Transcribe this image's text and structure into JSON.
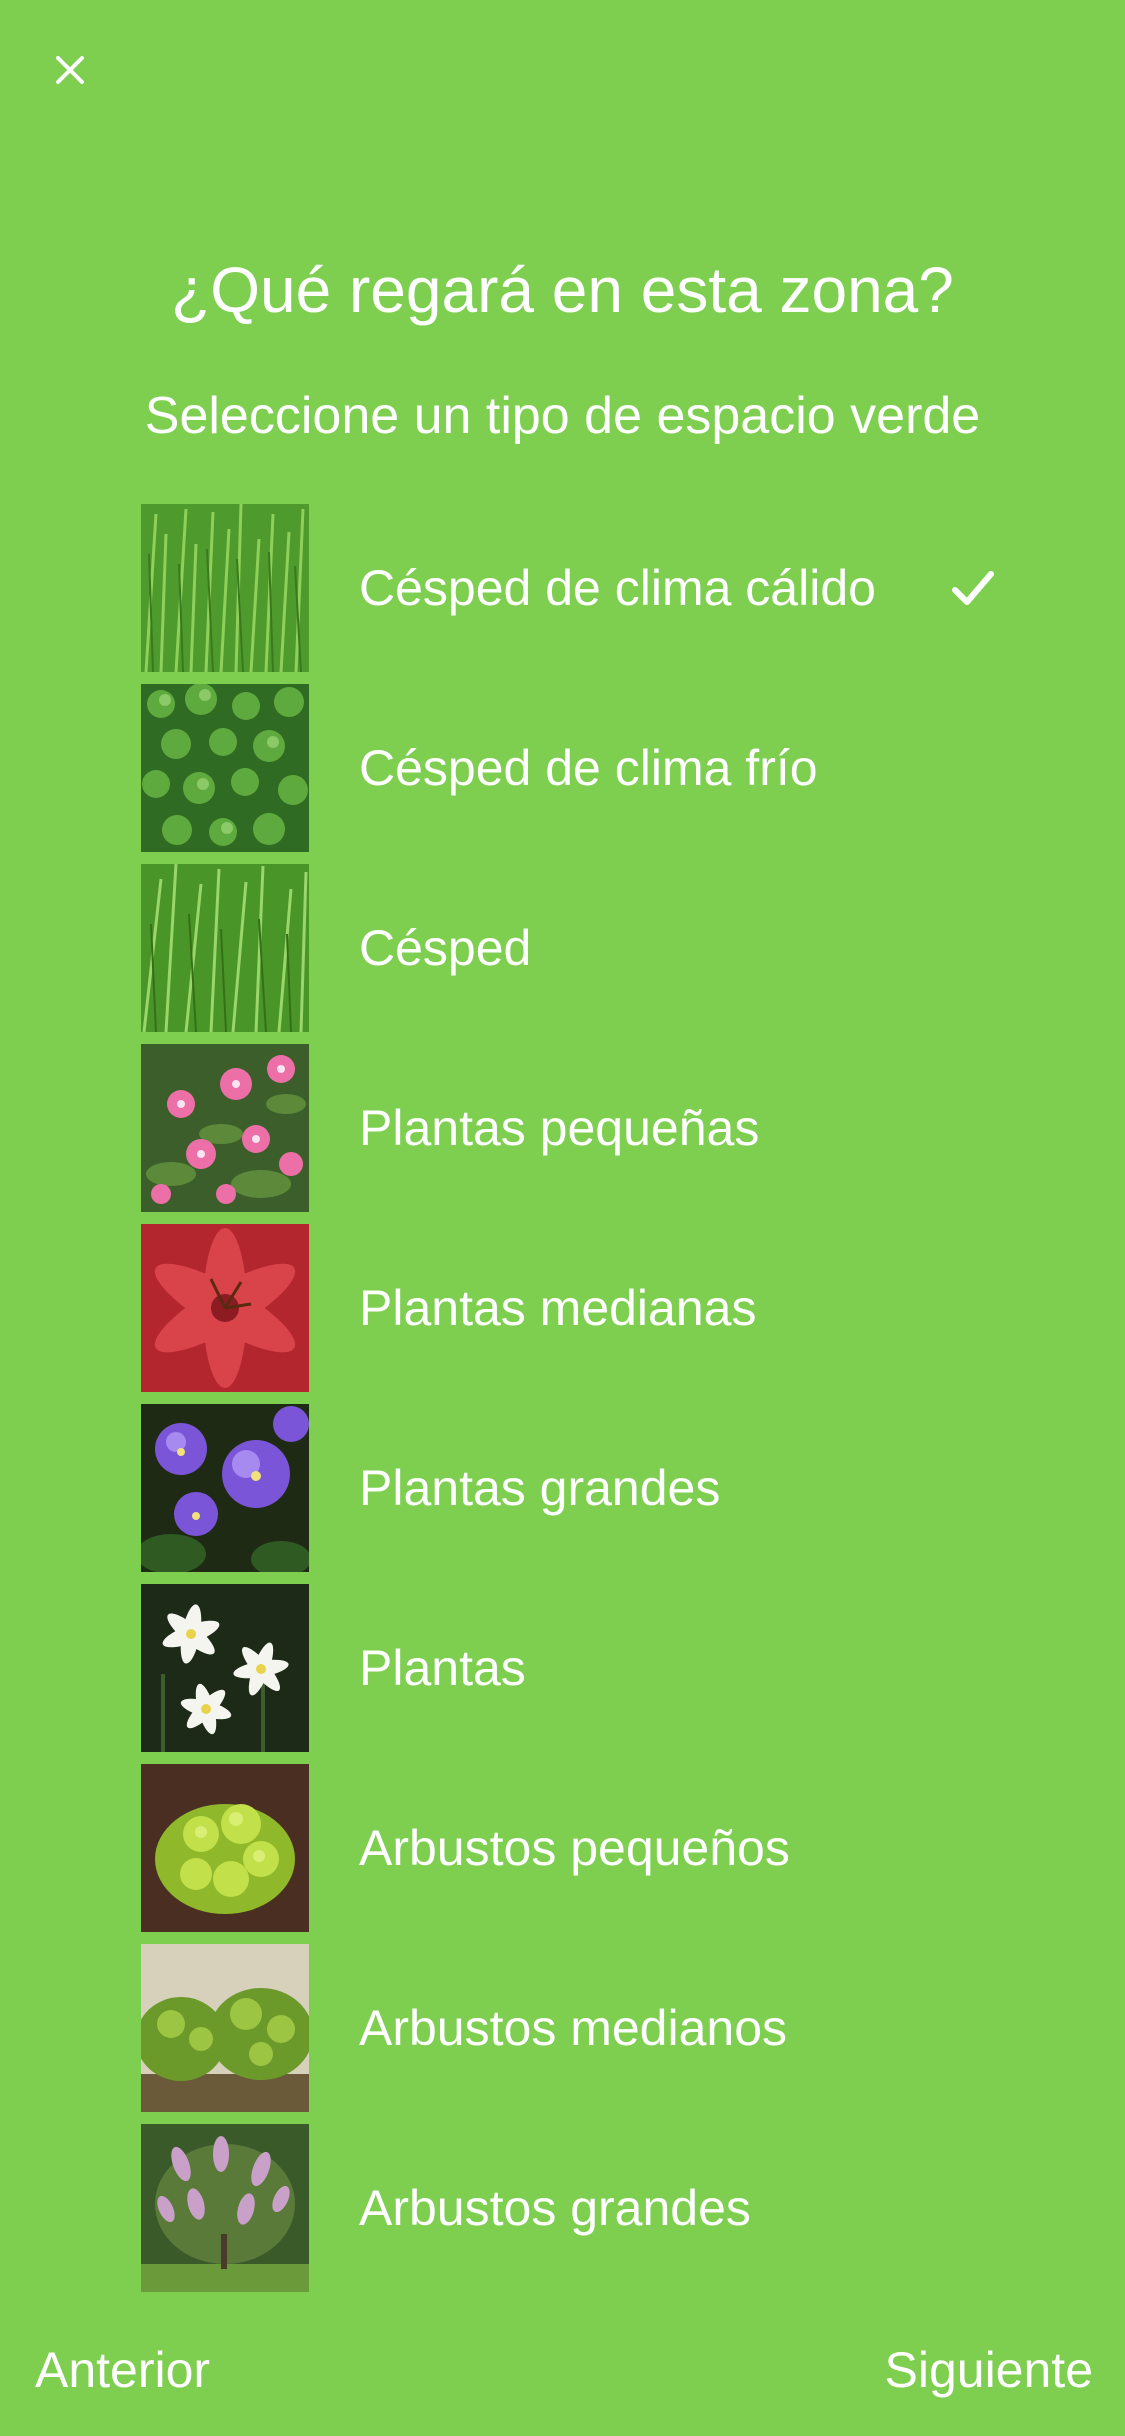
{
  "header": {
    "close_icon": "close-icon"
  },
  "title": "¿Qué regará en esta zona?",
  "subtitle": "Seleccione un tipo de espacio verde",
  "options": [
    {
      "label": "Césped de clima cálido",
      "image": "grass-warm",
      "selected": true
    },
    {
      "label": "Césped de clima frío",
      "image": "clover-cool"
    },
    {
      "label": "Césped",
      "image": "grass"
    },
    {
      "label": "Plantas pequeñas",
      "image": "pink-flowers"
    },
    {
      "label": "Plantas medianas",
      "image": "red-lily"
    },
    {
      "label": "Plantas grandes",
      "image": "purple-violets"
    },
    {
      "label": "Plantas",
      "image": "white-flowers"
    },
    {
      "label": "Arbustos pequeños",
      "image": "yellow-shrub"
    },
    {
      "label": "Arbustos medianos",
      "image": "hedge-shrubs"
    },
    {
      "label": "Arbustos grandes",
      "image": "flowering-bush"
    }
  ],
  "footer": {
    "prev_label": "Anterior",
    "next_label": "Siguiente"
  },
  "colors": {
    "background": "#7ecf50",
    "text": "#ffffff"
  }
}
